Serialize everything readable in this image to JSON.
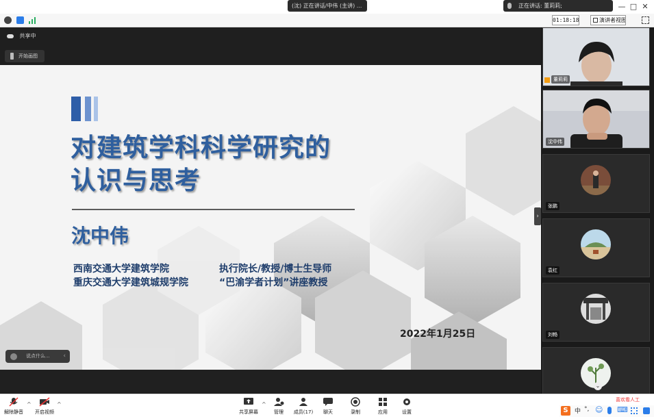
{
  "window": {
    "title_pill": "(沈) 正在讲话/中伟 (主讲) ...",
    "title_pill_icon": "grid-icon",
    "speaker_pill": "正在讲话: 董莉莉;",
    "controls": [
      "—",
      "□",
      "✕"
    ]
  },
  "info_bar": {
    "timer": "01:18:18",
    "view_button": "演讲者视图",
    "fullscreen_icon": "fullscreen-icon"
  },
  "share": {
    "label": "共享中",
    "annotate_label": "开始画图",
    "chat_placeholder": "说点什么...",
    "collapse_glyph": "›"
  },
  "slide": {
    "title_line1": "对建筑学科科学研究的",
    "title_line2": "认识与思考",
    "author": "沈中伟",
    "affiliation_left_1": "西南交通大学建筑学院",
    "affiliation_right_1": "执行院长/教授/博士生导师",
    "affiliation_left_2": "重庆交通大学建筑城规学院",
    "affiliation_right_2": "“巴渝学者计划”讲座教授",
    "date": "2022年1月25日",
    "accent_colors": [
      "#2e5ea8",
      "#6d93cf",
      "#aac3e8"
    ]
  },
  "participants": [
    {
      "name": "董莉莉",
      "type": "video"
    },
    {
      "name": "沈中伟",
      "type": "video"
    },
    {
      "name": "张鹏",
      "type": "avatar"
    },
    {
      "name": "袁红",
      "type": "avatar"
    },
    {
      "name": "刘畅",
      "type": "avatar"
    },
    {
      "name": "",
      "type": "avatar"
    }
  ],
  "toolbar": {
    "left": [
      {
        "label": "解除静音",
        "icon": "muted-mic-icon"
      },
      {
        "label": "开启视频",
        "icon": "video-off-icon"
      }
    ],
    "center": [
      {
        "label": "共享屏幕",
        "icon": "share-screen-icon"
      },
      {
        "label": "管理",
        "icon": "manage-icon"
      },
      {
        "label": "成员(17)",
        "icon": "members-icon"
      },
      {
        "label": "聊天",
        "icon": "chat-icon"
      },
      {
        "label": "录制",
        "icon": "record-icon"
      },
      {
        "label": "应用",
        "icon": "apps-icon"
      },
      {
        "label": "设置",
        "icon": "settings-icon"
      }
    ],
    "tray": [
      "中",
      "°,",
      "☺",
      "🎤",
      "⌨"
    ],
    "tray_ad": "喜欢看人工"
  }
}
